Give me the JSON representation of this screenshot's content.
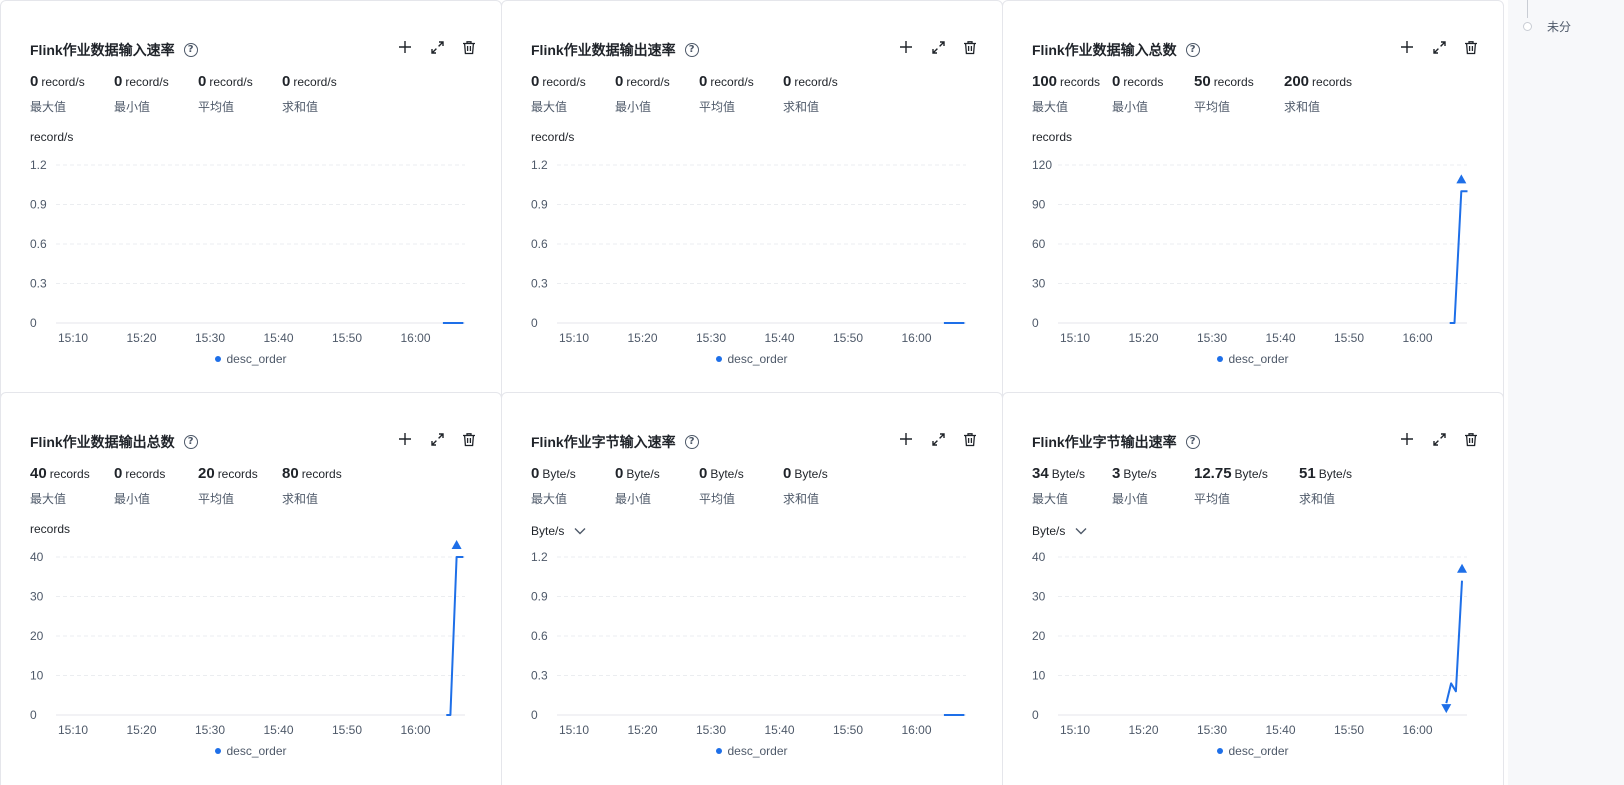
{
  "sidebar_right": {
    "text": "未分"
  },
  "cards": [
    {
      "title": "Flink作业数据输入速率",
      "unit": "record/s",
      "unit_dropdown": false,
      "stats": [
        {
          "value": "0",
          "unit": "record/s",
          "label": "最大值"
        },
        {
          "value": "0",
          "unit": "record/s",
          "label": "最小值"
        },
        {
          "value": "0",
          "unit": "record/s",
          "label": "平均值"
        },
        {
          "value": "0",
          "unit": "record/s",
          "label": "求和值"
        }
      ],
      "legend": "desc_order"
    },
    {
      "title": "Flink作业数据输出速率",
      "unit": "record/s",
      "unit_dropdown": false,
      "stats": [
        {
          "value": "0",
          "unit": "record/s",
          "label": "最大值"
        },
        {
          "value": "0",
          "unit": "record/s",
          "label": "最小值"
        },
        {
          "value": "0",
          "unit": "record/s",
          "label": "平均值"
        },
        {
          "value": "0",
          "unit": "record/s",
          "label": "求和值"
        }
      ],
      "legend": "desc_order"
    },
    {
      "title": "Flink作业数据输入总数",
      "unit": "records",
      "unit_dropdown": false,
      "stats": [
        {
          "value": "100",
          "unit": "records",
          "label": "最大值"
        },
        {
          "value": "0",
          "unit": "records",
          "label": "最小值"
        },
        {
          "value": "50",
          "unit": "records",
          "label": "平均值"
        },
        {
          "value": "200",
          "unit": "records",
          "label": "求和值"
        }
      ],
      "legend": "desc_order"
    },
    {
      "title": "Flink作业数据输出总数",
      "unit": "records",
      "unit_dropdown": false,
      "stats": [
        {
          "value": "40",
          "unit": "records",
          "label": "最大值"
        },
        {
          "value": "0",
          "unit": "records",
          "label": "最小值"
        },
        {
          "value": "20",
          "unit": "records",
          "label": "平均值"
        },
        {
          "value": "80",
          "unit": "records",
          "label": "求和值"
        }
      ],
      "legend": "desc_order"
    },
    {
      "title": "Flink作业字节输入速率",
      "unit": "Byte/s",
      "unit_dropdown": true,
      "stats": [
        {
          "value": "0",
          "unit": "Byte/s",
          "label": "最大值"
        },
        {
          "value": "0",
          "unit": "Byte/s",
          "label": "最小值"
        },
        {
          "value": "0",
          "unit": "Byte/s",
          "label": "平均值"
        },
        {
          "value": "0",
          "unit": "Byte/s",
          "label": "求和值"
        }
      ],
      "legend": "desc_order"
    },
    {
      "title": "Flink作业字节输出速率",
      "unit": "Byte/s",
      "unit_dropdown": true,
      "stats": [
        {
          "value": "34",
          "unit": "Byte/s",
          "label": "最大值"
        },
        {
          "value": "3",
          "unit": "Byte/s",
          "label": "最小值"
        },
        {
          "value": "12.75",
          "unit": "Byte/s",
          "label": "平均值"
        },
        {
          "value": "51",
          "unit": "Byte/s",
          "label": "求和值"
        }
      ],
      "legend": "desc_order"
    }
  ],
  "chart_data": [
    {
      "type": "line",
      "title": "Flink作业数据输入速率",
      "ylabel": "record/s",
      "yticks": [
        0,
        0.3,
        0.6,
        0.9,
        1.2
      ],
      "ylim": [
        0,
        1.2
      ],
      "xticks": [
        "15:10",
        "15:20",
        "15:30",
        "15:40",
        "15:50",
        "16:00"
      ],
      "xlim_min": [
        5,
        68
      ],
      "series": [
        {
          "name": "desc_order",
          "color": "#1e6fe8",
          "points": [
            [
              64,
              0
            ],
            [
              67,
              0
            ]
          ]
        }
      ],
      "markers": [],
      "grid": true,
      "legend": "bottom"
    },
    {
      "type": "line",
      "title": "Flink作业数据输出速率",
      "ylabel": "record/s",
      "yticks": [
        0,
        0.3,
        0.6,
        0.9,
        1.2
      ],
      "ylim": [
        0,
        1.2
      ],
      "xticks": [
        "15:10",
        "15:20",
        "15:30",
        "15:40",
        "15:50",
        "16:00"
      ],
      "xlim_min": [
        5,
        68
      ],
      "series": [
        {
          "name": "desc_order",
          "color": "#1e6fe8",
          "points": [
            [
              64,
              0
            ],
            [
              67,
              0
            ]
          ]
        }
      ],
      "markers": [],
      "grid": true,
      "legend": "bottom"
    },
    {
      "type": "line",
      "title": "Flink作业数据输入总数",
      "ylabel": "records",
      "yticks": [
        0,
        30,
        60,
        90,
        120
      ],
      "ylim": [
        0,
        120
      ],
      "xticks": [
        "15:10",
        "15:20",
        "15:30",
        "15:40",
        "15:50",
        "16:00"
      ],
      "xlim_min": [
        5,
        68
      ],
      "series": [
        {
          "name": "desc_order",
          "color": "#1e6fe8",
          "points": [
            [
              64.7,
              0
            ],
            [
              65.4,
              0
            ],
            [
              66.4,
              100
            ],
            [
              67.3,
              100
            ]
          ]
        }
      ],
      "markers": [
        {
          "kind": "max",
          "x": 66.4,
          "y": 100
        }
      ],
      "grid": true,
      "legend": "bottom"
    },
    {
      "type": "line",
      "title": "Flink作业数据输出总数",
      "ylabel": "records",
      "yticks": [
        0,
        10,
        20,
        30,
        40
      ],
      "ylim": [
        0,
        40
      ],
      "xticks": [
        "15:10",
        "15:20",
        "15:30",
        "15:40",
        "15:50",
        "16:00"
      ],
      "xlim_min": [
        5,
        68
      ],
      "series": [
        {
          "name": "desc_order",
          "color": "#1e6fe8",
          "points": [
            [
              64.5,
              0
            ],
            [
              65.1,
              0
            ],
            [
              66,
              40
            ],
            [
              67,
              40
            ]
          ]
        }
      ],
      "markers": [
        {
          "kind": "max",
          "x": 66,
          "y": 40
        }
      ],
      "grid": true,
      "legend": "bottom"
    },
    {
      "type": "line",
      "title": "Flink作业字节输入速率",
      "ylabel": "Byte/s",
      "yticks": [
        0,
        0.3,
        0.6,
        0.9,
        1.2
      ],
      "ylim": [
        0,
        1.2
      ],
      "xticks": [
        "15:10",
        "15:20",
        "15:30",
        "15:40",
        "15:50",
        "16:00"
      ],
      "xlim_min": [
        5,
        68
      ],
      "series": [
        {
          "name": "desc_order",
          "color": "#1e6fe8",
          "points": [
            [
              64,
              0
            ],
            [
              67,
              0
            ]
          ]
        }
      ],
      "markers": [],
      "grid": true,
      "legend": "bottom"
    },
    {
      "type": "line",
      "title": "Flink作业字节输出速率",
      "ylabel": "Byte/s",
      "yticks": [
        0,
        10,
        20,
        30,
        40
      ],
      "ylim": [
        0,
        40
      ],
      "xticks": [
        "15:10",
        "15:20",
        "15:30",
        "15:40",
        "15:50",
        "16:00"
      ],
      "xlim_min": [
        5,
        68
      ],
      "series": [
        {
          "name": "desc_order",
          "color": "#1e6fe8",
          "points": [
            [
              64.2,
              3
            ],
            [
              64.9,
              8
            ],
            [
              65.6,
              6
            ],
            [
              66.5,
              34
            ]
          ]
        }
      ],
      "markers": [
        {
          "kind": "min",
          "x": 64.2,
          "y": 3
        },
        {
          "kind": "max",
          "x": 66.5,
          "y": 34
        }
      ],
      "grid": true,
      "legend": "bottom"
    }
  ]
}
